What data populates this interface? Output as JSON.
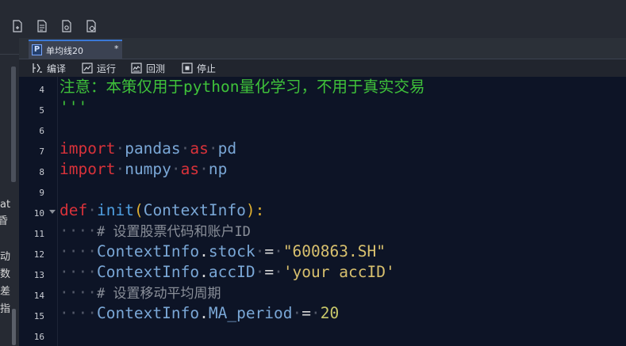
{
  "topbar": {
    "icons": [
      "document-add-icon",
      "document-edit-icon",
      "document-settings-icon",
      "document-gear-icon"
    ]
  },
  "left_panel": {
    "labels": [
      "at",
      "昏",
      "动",
      "数",
      "差",
      "指"
    ]
  },
  "tab": {
    "icon_letter": "P",
    "label": "单均线20",
    "modified": "*"
  },
  "toolbar": {
    "compile": "编译",
    "run": "运行",
    "backtest": "回测",
    "stop": "停止"
  },
  "editor": {
    "line_numbers": [
      "4",
      "5",
      "6",
      "7",
      "8",
      "9",
      "10",
      "11",
      "12",
      "13",
      "14",
      "15",
      "16"
    ],
    "lines": {
      "l4": "注意：本策仅用于python量化学习，不用于真实交易",
      "l5": "'''",
      "l7_kw": "import",
      "l7_mod": "pandas",
      "l7_as": "as",
      "l7_alias": "pd",
      "l8_kw": "import",
      "l8_mod": "numpy",
      "l8_as": "as",
      "l8_alias": "np",
      "l10_def": "def",
      "l10_fn": "init",
      "l10_open": "(",
      "l10_param": "ContextInfo",
      "l10_close": "):",
      "l11_comment": "# 设置股票代码和账户ID",
      "l12_obj": "ContextInfo",
      "l12_attr": "stock",
      "l12_op": "=",
      "l12_val": "\"600863.SH\"",
      "l13_obj": "ContextInfo",
      "l13_attr": "accID",
      "l13_op": "=",
      "l13_val": "'your accID'",
      "l14_comment": "# 设置移动平均周期",
      "l15_obj": "ContextInfo",
      "l15_attr": "MA_period",
      "l15_op": "=",
      "l15_val": "20"
    }
  }
}
